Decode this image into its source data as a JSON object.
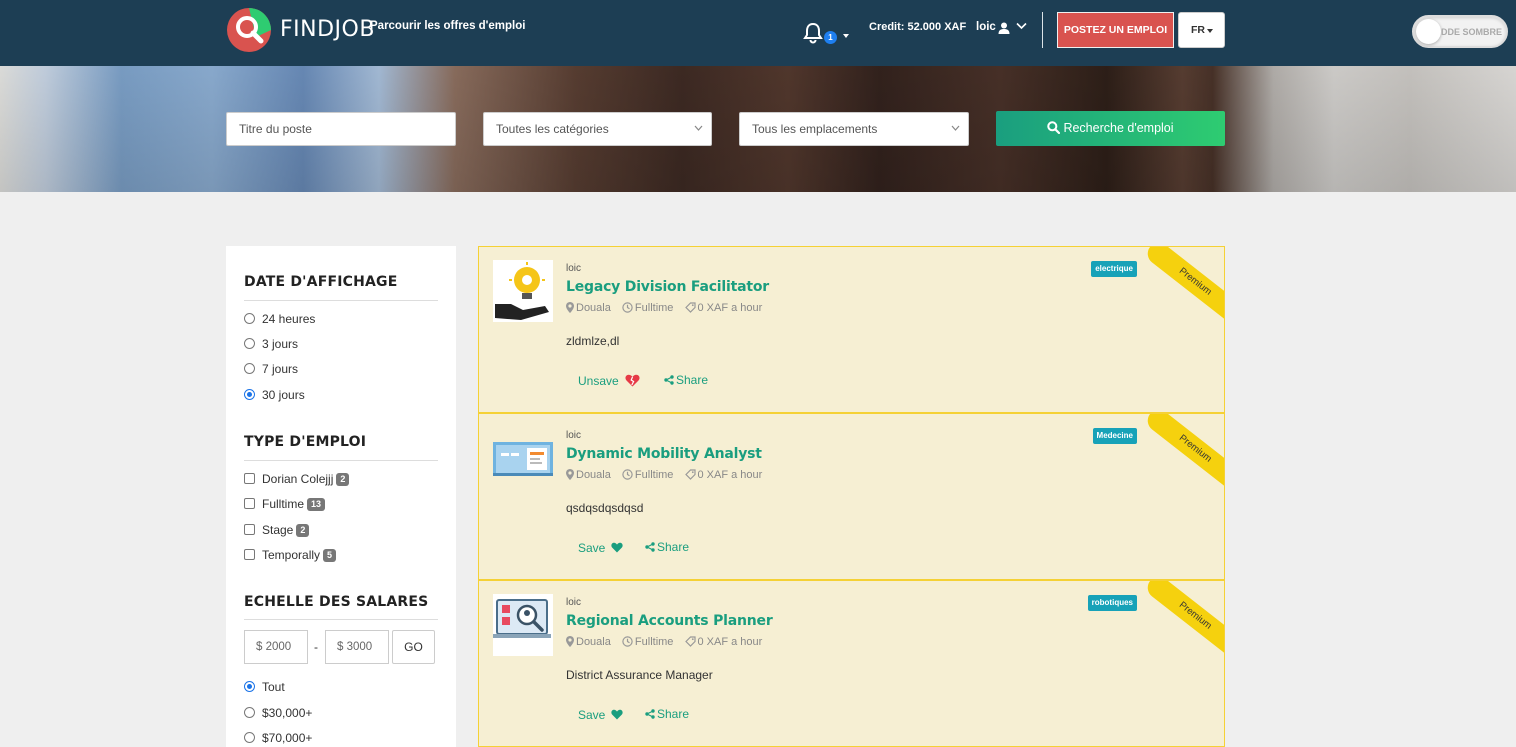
{
  "header": {
    "brand": "FINDJOB",
    "browse_link": "Parcourir les offres d'emploi",
    "notification_count": "1",
    "credit": "Credit: 52.000 XAF",
    "username": "loic",
    "post_job_button": "POSTEZ UN EMPLOI",
    "language": "FR",
    "dark_mode_label": "DDE SOMBRE",
    "logo_colors": {
      "red": "#d9534f",
      "green": "#2ecc71"
    }
  },
  "search": {
    "title_placeholder": "Titre du poste",
    "category_select": "Toutes les catégories",
    "location_select": "Tous les emplacements",
    "search_button": "Recherche d'emploi"
  },
  "sidebar": {
    "date_section": {
      "title": "DATE D'AFFICHAGE",
      "options": [
        {
          "label": "24 heures",
          "selected": false
        },
        {
          "label": "3 jours",
          "selected": false
        },
        {
          "label": "7 jours",
          "selected": false
        },
        {
          "label": "30 jours",
          "selected": true
        }
      ]
    },
    "type_section": {
      "title": "TYPE D'EMPLOI",
      "options": [
        {
          "label": "Dorian Colejjj",
          "count": "2"
        },
        {
          "label": "Fulltime",
          "count": "13"
        },
        {
          "label": "Stage",
          "count": "2"
        },
        {
          "label": "Temporally",
          "count": "5"
        }
      ]
    },
    "salary_section": {
      "title": "ECHELLE DES SALARES",
      "min_placeholder": "$ 2000",
      "max_placeholder": "$ 3000",
      "separator": "-",
      "go_button": "GO",
      "options": [
        {
          "label": "Tout",
          "selected": true
        },
        {
          "label": "$30,000+",
          "selected": false
        },
        {
          "label": "$70,000+",
          "selected": false
        }
      ]
    }
  },
  "jobs": [
    {
      "poster": "loic",
      "title": "Legacy Division Facilitator",
      "location": "Douala",
      "type": "Fulltime",
      "salary": "0 XAF a hour",
      "description": "zldmlze,dl",
      "save_label": "Unsave",
      "save_icon": "broken-heart-icon",
      "share_label": "Share",
      "category": "electrique",
      "premium_label": "Premium"
    },
    {
      "poster": "loic",
      "title": "Dynamic Mobility Analyst",
      "location": "Douala",
      "type": "Fulltime",
      "salary": "0 XAF a hour",
      "description": "qsdqsdqsdqsd",
      "save_label": "Save",
      "save_icon": "heart-icon",
      "share_label": "Share",
      "category": "Medecine",
      "premium_label": "Premium"
    },
    {
      "poster": "loic",
      "title": "Regional Accounts Planner",
      "location": "Douala",
      "type": "Fulltime",
      "salary": "0 XAF a hour",
      "description": "District Assurance Manager",
      "save_label": "Save",
      "save_icon": "heart-icon",
      "share_label": "Share",
      "category": "robotiques",
      "premium_label": "Premium"
    }
  ],
  "colors": {
    "header_bg": "#1d3e54",
    "accent_green": "#1a9e7f",
    "post_button": "#d9534f",
    "card_bg": "#f6efd3",
    "card_border": "#f5d135",
    "badge": "#17a2b8",
    "ribbon": "#f5d10e"
  }
}
